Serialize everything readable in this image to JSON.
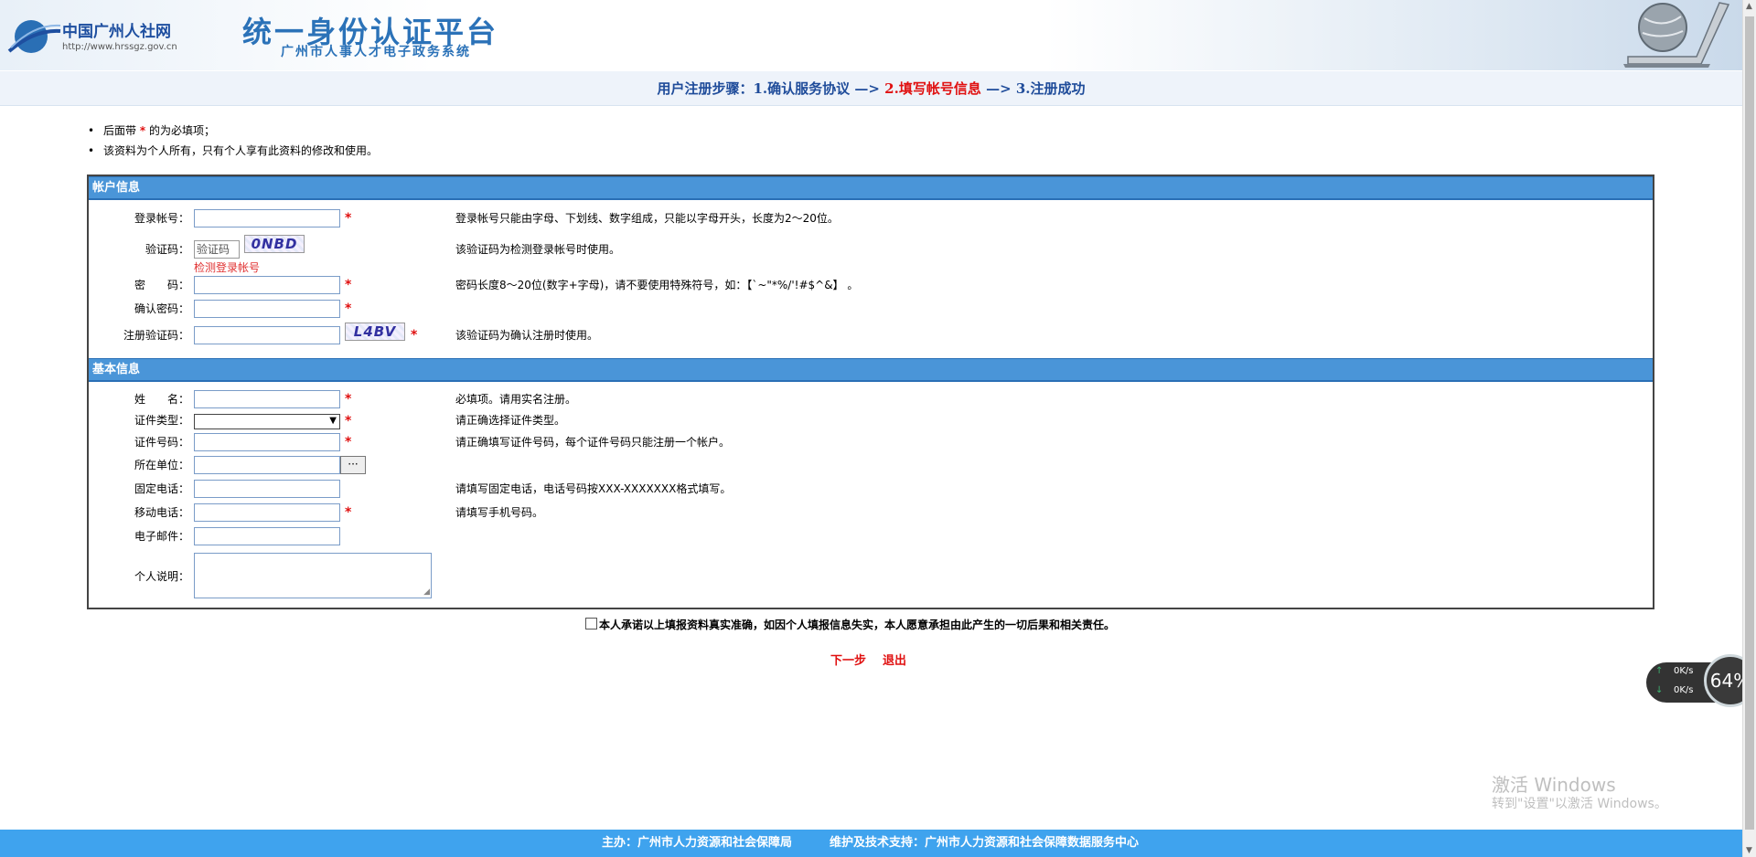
{
  "header": {
    "logo_text": "中国广州人社网",
    "logo_url": "http://www.hrssgz.gov.cn",
    "title": "统一身份认证平台",
    "subtitle": "广州市人事人才电子政务系统"
  },
  "steps": {
    "prefix": "用户注册步骤：",
    "step1": "1.确认服务协议",
    "sep1": " —> ",
    "step2": "2.填写帐号信息",
    "sep2": " —> ",
    "step3": "3.注册成功"
  },
  "notes": {
    "line1_before": "后面带",
    "line1_star": "*",
    "line1_after": "的为必填项；",
    "line2": "该资料为个人所有，只有个人享有此资料的修改和使用。"
  },
  "account_section": {
    "title": "帐户信息",
    "login_label": "登录帐号：",
    "login_hint": "登录帐号只能由字母、下划线、数字组成，只能以字母开头，长度为2～20位。",
    "captcha_label": "验证码：",
    "captcha_placeholder": "验证码",
    "captcha_image_text": "0NBD",
    "check_link": "检测登录帐号",
    "captcha_hint": "该验证码为检测登录帐号时使用。",
    "password_label": "密　　码：",
    "password_hint": "密码长度8～20位(数字+字母)，请不要使用特殊符号，如：【`~\"*%/'!#$^&】 。",
    "confirm_label": "确认密码：",
    "reg_captcha_label": "注册验证码：",
    "reg_captcha_image_text": "L4BV",
    "reg_captcha_hint": "该验证码为确认注册时使用。"
  },
  "basic_section": {
    "title": "基本信息",
    "name_label": "姓　　名：",
    "name_hint": "必填项。请用实名注册。",
    "idtype_label": "证件类型：",
    "idtype_hint": "请正确选择证件类型。",
    "idno_label": "证件号码：",
    "idno_hint": "请正确填写证件号码，每个证件号码只能注册一个帐户。",
    "unit_label": "所在单位：",
    "unit_button": "···",
    "phone_label": "固定电话：",
    "phone_hint": "请填写固定电话，电话号码按XXX-XXXXXXX格式填写。",
    "mobile_label": "移动电话：",
    "mobile_hint": "请填写手机号码。",
    "email_label": "电子邮件：",
    "bio_label": "个人说明："
  },
  "required_mark": "*",
  "agreement": "本人承诺以上填报资料真实准确，如因个人填报信息失实，本人愿意承担由此产生的一切后果和相关责任。",
  "actions": {
    "next": "下一步",
    "exit": "退出"
  },
  "speed_widget": {
    "up": "0K/s",
    "down": "0K/s",
    "percent": "64%"
  },
  "watermark": {
    "line1": "激活 Windows",
    "line2": "转到\"设置\"以激活 Windows。"
  },
  "footer": {
    "host": "主办：广州市人力资源和社会保障局",
    "support": "维护及技术支持：广州市人力资源和社会保障数据服务中心"
  },
  "colors": {
    "primary_blue": "#4a95d8",
    "required_red": "#e01010",
    "footer_blue": "#3fa3ee"
  }
}
